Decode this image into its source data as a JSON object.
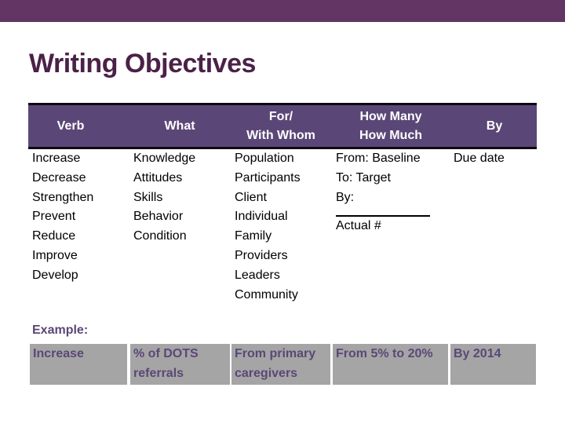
{
  "theme": {
    "top_bar_color": "#633564",
    "title_color": "#4b2147",
    "header_bg": "#5b4777",
    "header_border": "#0d0a14",
    "example_bg": "#a5a5a5",
    "example_text": "#5b4777"
  },
  "title": "Writing Objectives",
  "table": {
    "headers": [
      {
        "line1": "Verb",
        "line2": ""
      },
      {
        "line1": "What",
        "line2": ""
      },
      {
        "line1": "For/",
        "line2": "With Whom"
      },
      {
        "line1": "How Many",
        "line2": "How Much"
      },
      {
        "line1": "By",
        "line2": ""
      }
    ],
    "columns": {
      "verb": [
        "Increase",
        "Decrease",
        "Strengthen",
        "Prevent",
        "Reduce",
        "Improve",
        "Develop"
      ],
      "what": [
        "Knowledge",
        "Attitudes",
        "Skills",
        "Behavior",
        "Condition"
      ],
      "for_whom": [
        "Population",
        "Participants",
        "Client",
        "Individual",
        "Family",
        "Providers",
        "Leaders",
        "Community"
      ],
      "how_much": {
        "from": "From: Baseline",
        "to": "To: Target",
        "by": "By:",
        "actual": "Actual #"
      },
      "by": [
        "Due date"
      ]
    }
  },
  "example": {
    "label": "Example:",
    "cells": [
      {
        "line1": "Increase",
        "line2": ""
      },
      {
        "line1": "% of DOTS",
        "line2": "referrals"
      },
      {
        "line1": "From primary",
        "line2": "caregivers"
      },
      {
        "line1": "From 5% to 20%",
        "line2": ""
      },
      {
        "line1": "By 2014",
        "line2": ""
      }
    ]
  }
}
